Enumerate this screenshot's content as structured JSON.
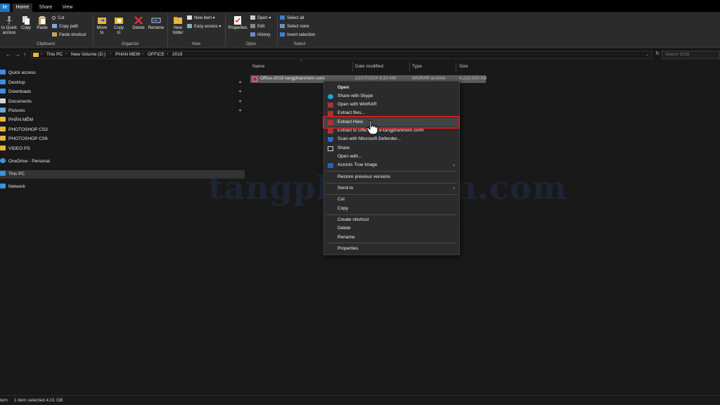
{
  "tabs": {
    "file": "ile",
    "home": "Home",
    "share": "Share",
    "view": "View"
  },
  "ribbon": {
    "pin_label_1": "to Quick",
    "pin_label_2": "access",
    "copy": "Copy",
    "paste": "Paste",
    "cut": "Cut",
    "copy_path": "Copy path",
    "paste_shortcut": "Paste shortcut",
    "clipboard_group": "Clipboard",
    "move_to_1": "Move",
    "move_to_2": "to",
    "copy_to_1": "Copy",
    "copy_to_2": "to",
    "delete": "Delete",
    "rename": "Rename",
    "organize_group": "Organize",
    "new_folder_1": "New",
    "new_folder_2": "folder",
    "new_item": "New item",
    "easy_access": "Easy access",
    "new_group": "New",
    "properties": "Properties",
    "open": "Open",
    "edit": "Edit",
    "history": "History",
    "open_group": "Open",
    "select_all": "Select all",
    "select_none": "Select none",
    "invert_selection": "Invert selection",
    "select_group": "Select"
  },
  "address": {
    "crumbs": [
      "This PC",
      "New Volume (D:)",
      "PHAN MEM",
      "OFFICE",
      "2019"
    ],
    "search_placeholder": "Search 2019"
  },
  "nav": {
    "quick_access": "Quick access",
    "items": [
      "Desktop",
      "Downloads",
      "Documents",
      "Pictures",
      "PHẦN MỀM",
      "PHOTOSHOP CS3",
      "PHOTOSHOP CS6",
      "VIDEO PS"
    ],
    "onedrive": "OneDrive - Personal",
    "this_pc": "This PC",
    "network": "Network"
  },
  "columns": {
    "name": "Name",
    "date": "Date modified",
    "type": "Type",
    "size": "Size"
  },
  "file": {
    "name": "Office-2019-tangphanmem-com",
    "date": "12/17/2024 9:20 AM",
    "type": "WinRAR archive",
    "size": "4,210,543 KB"
  },
  "menu": {
    "open": "Open",
    "share_skype": "Share with Skype",
    "open_winrar": "Open with WinRAR",
    "extract_files": "Extract files...",
    "extract_here": "Extract Here",
    "extract_to": "Extract to Office-2019-tangphanmem-com\\",
    "scan_defender": "Scan with Microsoft Defender...",
    "share": "Share",
    "open_with": "Open with...",
    "acronis": "Acronis True Image",
    "restore": "Restore previous versions",
    "send_to": "Send to",
    "cut": "Cut",
    "copy": "Copy",
    "create_shortcut": "Create shortcut",
    "delete": "Delete",
    "rename": "Rename",
    "properties": "Properties"
  },
  "status": {
    "items": "tem",
    "selected": "1 item selected  4.01 GB"
  },
  "watermark": "tangphanmem.com",
  "colors": {
    "accent": "#1a73c5",
    "highlight_border": "#d21f1f",
    "folder": "#e8b73a",
    "menu_bg": "#2b2b2b"
  }
}
